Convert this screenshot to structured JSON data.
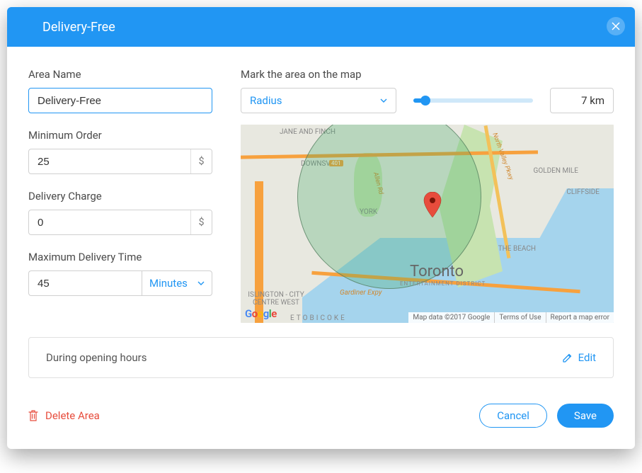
{
  "header": {
    "title": "Delivery-Free"
  },
  "form": {
    "areaName": {
      "label": "Area Name",
      "value": "Delivery-Free"
    },
    "minOrder": {
      "label": "Minimum Order",
      "value": "25",
      "currency": "$"
    },
    "deliveryCharge": {
      "label": "Delivery Charge",
      "value": "0",
      "currency": "$"
    },
    "maxTime": {
      "label": "Maximum Delivery Time",
      "value": "45",
      "unit": "Minutes"
    }
  },
  "mapConfig": {
    "label": "Mark the area on the map",
    "mode": "Radius",
    "radiusDisplay": "7 km"
  },
  "map": {
    "cityLabel": "Toronto",
    "entLabel": "ENTERTAINMENT DISTRICT",
    "labels": [
      "JANE AND FINCH",
      "DOWNSVIEW",
      "YORK",
      "ISLINGTON - CITY CENTRE WEST",
      "GOLDEN MILE",
      "CLIFFSIDE",
      "THE BEACH",
      "ETOBICOKE",
      "Gardiner Expy",
      "401",
      "North Valley Pkwy",
      "Allen Rd"
    ],
    "attrib": {
      "data": "Map data ©2017 Google",
      "terms": "Terms of Use",
      "report": "Report a map error"
    }
  },
  "hours": {
    "text": "During opening hours",
    "edit": "Edit"
  },
  "footer": {
    "delete": "Delete Area",
    "cancel": "Cancel",
    "save": "Save"
  }
}
